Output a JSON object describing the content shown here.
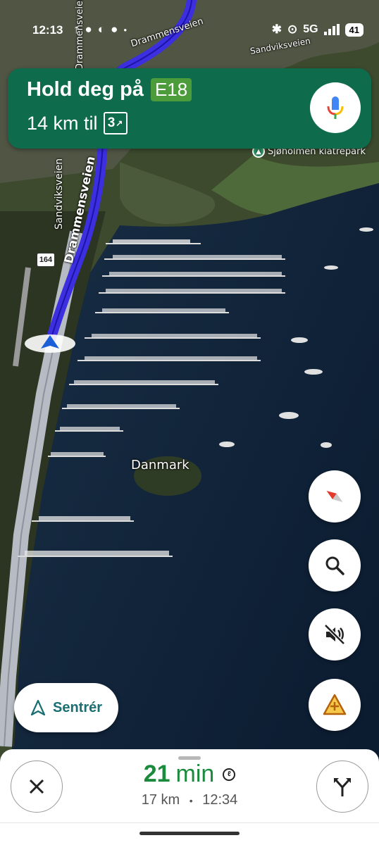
{
  "status_bar": {
    "time": "12:13",
    "network": "5G",
    "battery": "41"
  },
  "map": {
    "road_labels": {
      "drammensveien_top": "Drammensveien",
      "drammensveien_main": "Drammensveien",
      "drammensveien_vertical": "Drammensveien",
      "sandviksveien_top": "Sandviksveien",
      "sandviksveien_left": "Sandviksveien"
    },
    "road_shield": "164",
    "poi": "Sjøholmen klatrepark",
    "place": "Danmark",
    "route_color": "#3b2fe0"
  },
  "navigation": {
    "instruction": "Hold deg på",
    "route_badge": "E18",
    "distance_text": "14 km til",
    "exit_number": "3",
    "banner_color": "#0e6b4c"
  },
  "controls": {
    "recenter_label": "Sentrér"
  },
  "trip": {
    "minutes": "21",
    "minutes_unit": "min",
    "distance": "17 km",
    "separator": "•",
    "arrival": "12:34"
  }
}
